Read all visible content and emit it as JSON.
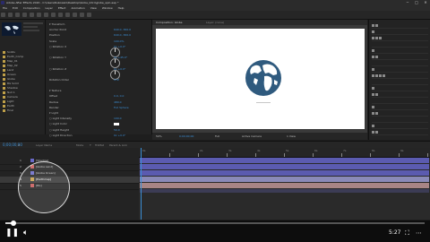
{
  "window": {
    "title": "Adobe After Effects 2020 - C:\\Users\\Rukowski\\Desktop\\Globe_Intro\\globe_spin.aep *",
    "controls": [
      "─",
      "□",
      "✕"
    ]
  },
  "menu": [
    "File",
    "Edit",
    "Composition",
    "Layer",
    "Effect",
    "Animation",
    "View",
    "Window",
    "Help"
  ],
  "project": {
    "items": [
      "Solids",
      "Earth_Comp",
      "Map_01",
      "Map_02",
      "Land",
      "Ocean",
      "Globe",
      "BG Solid",
      "Shadow",
      "Null 1",
      "Camera",
      "Light",
      "Earth",
      "Final"
    ]
  },
  "effects": {
    "rows": [
      {
        "label": "▾ Transform",
        "value": ""
      },
      {
        "label": "  Anchor Point",
        "value": "640.0, 360.0"
      },
      {
        "label": "  Position",
        "value": "640.0, 360.0"
      },
      {
        "label": "  Scale",
        "value": "100.0%"
      },
      {
        "label": "  ○ Rotation X",
        "value": "0x +0.0°"
      },
      {
        "label": "",
        "value": ""
      },
      {
        "label": "  ○ Rotation Y",
        "value": "0x +45.0°"
      },
      {
        "label": "",
        "value": ""
      },
      {
        "label": "  ○ Rotation Z",
        "value": "0x +0.0°"
      },
      {
        "label": "",
        "value": ""
      },
      {
        "label": "  Rotation Order",
        "value": "XYZ"
      },
      {
        "label": "",
        "value": ""
      },
      {
        "label": "▾ Texture",
        "value": ""
      },
      {
        "label": "  Offset",
        "value": "0.0, 0.0"
      },
      {
        "label": "  Radius",
        "value": "480.0"
      },
      {
        "label": "  Render",
        "value": "Full Sphere"
      },
      {
        "label": "▾ Light",
        "value": ""
      },
      {
        "label": "  ○ Light Intensity",
        "value": "100.0"
      },
      {
        "label": "  ○ Light Color",
        "value": ""
      },
      {
        "label": "  ○ Light Height",
        "value": "50.0"
      },
      {
        "label": "  ○ Light Direction",
        "value": "0x +0.0°"
      }
    ]
  },
  "composition": {
    "tabs": [
      "Composition: Globe",
      "Layer: (none)"
    ],
    "footer": [
      "50%",
      "0;00;00;00",
      "Full",
      "Active Camera",
      "1 View"
    ]
  },
  "timeline": {
    "timecode": "0;00;00;00",
    "columns": [
      "#",
      "Layer Name",
      "Mode",
      "T",
      "TrkMat",
      "Parent & Link"
    ],
    "layers": [
      {
        "num": "1",
        "name": "[Shadow]",
        "color": "#6a6ac8"
      },
      {
        "num": "2",
        "name": "[Globe Land]",
        "color": "#c85a5a"
      },
      {
        "num": "3",
        "name": "[Globe Ocean]",
        "color": "#6a6ac8"
      },
      {
        "num": "4",
        "name": "[Earthmap]",
        "color": "#c8a04a"
      },
      {
        "num": "5",
        "name": "[BG]",
        "color": "#c85a5a"
      }
    ],
    "ruler": [
      "0s",
      "1s",
      "2s",
      "3s",
      "4s",
      "5s",
      "6s",
      "7s",
      "8s",
      "9s",
      "10s"
    ]
  },
  "player": {
    "time": "5:27",
    "progress": 0.02
  },
  "colors": {
    "accent": "#3b8fd6",
    "globe_land": "#ffffff",
    "globe_ocean": "#2f5a7e"
  }
}
